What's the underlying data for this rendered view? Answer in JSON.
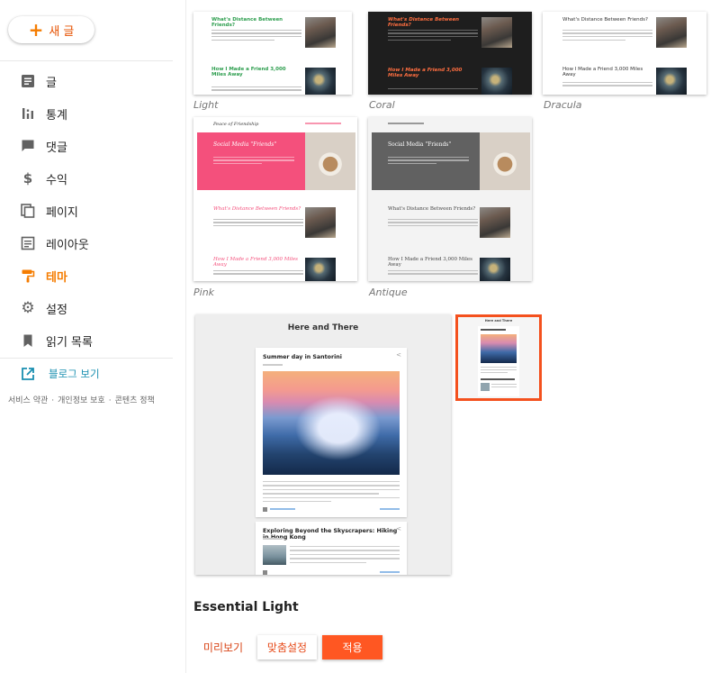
{
  "sidebar": {
    "new_post": "새 글",
    "items": [
      {
        "label": "글",
        "icon": "posts-icon"
      },
      {
        "label": "통계",
        "icon": "stats-icon"
      },
      {
        "label": "댓글",
        "icon": "comments-icon"
      },
      {
        "label": "수익",
        "icon": "earnings-icon"
      },
      {
        "label": "페이지",
        "icon": "pages-icon"
      },
      {
        "label": "레이아웃",
        "icon": "layout-icon"
      },
      {
        "label": "테마",
        "icon": "theme-icon"
      },
      {
        "label": "설정",
        "icon": "settings-icon"
      },
      {
        "label": "읽기 목록",
        "icon": "reading-list-icon"
      }
    ],
    "view_blog": "블로그 보기",
    "footer": [
      "서비스 약관",
      "개인정보 보호",
      "콘텐츠 정책"
    ],
    "active_color": "#f57c00"
  },
  "themes": {
    "light": {
      "label": "Light",
      "post1": "What's Distance Between Friends?",
      "post2": "How I Made a Friend 3,000 Miles Away"
    },
    "coral": {
      "label": "Coral",
      "post1": "What's Distance Between Friends?",
      "post2": "How I Made a Friend 3,000 Miles Away"
    },
    "dracula": {
      "label": "Dracula",
      "post1": "What's Distance Between Friends?",
      "post2": "How I Made a Friend 3,000 Miles Away"
    },
    "pink": {
      "label": "Pink",
      "blog_title": "Peace of Friendship",
      "hero": "Social Media \"Friends\"",
      "post1": "What's Distance Between Friends?",
      "post2": "How I Made a Friend 3,000 Miles Away"
    },
    "antique": {
      "label": "Antique",
      "hero": "Social Media \"Friends\"",
      "post1": "What's Distance Between Friends?",
      "post2": "How I Made a Friend 3,000 Miles Away"
    }
  },
  "preview": {
    "blog_title": "Here and There",
    "post1_title": "Summer day in Santorini",
    "post2_title": "Exploring Beyond the Skyscrapers: Hiking in Hong Kong"
  },
  "selected_theme": {
    "name": "Essential Light",
    "mini_title": "Here and There"
  },
  "actions": {
    "preview": "미리보기",
    "customize": "맞춤설정",
    "apply": "적용"
  },
  "colors": {
    "accent": "#ff5722",
    "coral_title": "#ff6e40",
    "light_title": "#2e9e4f",
    "pink_hero": "#f4507c",
    "antique_hero": "#616161"
  }
}
